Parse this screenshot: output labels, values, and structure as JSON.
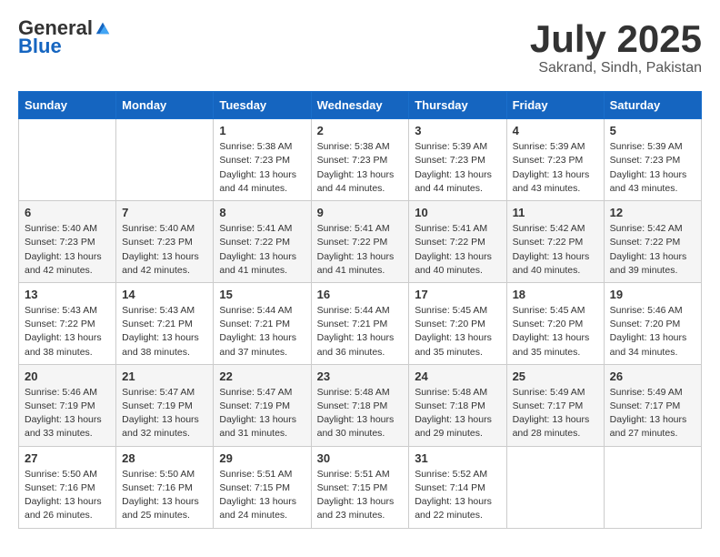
{
  "header": {
    "logo_general": "General",
    "logo_blue": "Blue",
    "month": "July 2025",
    "location": "Sakrand, Sindh, Pakistan"
  },
  "days_of_week": [
    "Sunday",
    "Monday",
    "Tuesday",
    "Wednesday",
    "Thursday",
    "Friday",
    "Saturday"
  ],
  "weeks": [
    [
      {
        "day": "",
        "sunrise": "",
        "sunset": "",
        "daylight": ""
      },
      {
        "day": "",
        "sunrise": "",
        "sunset": "",
        "daylight": ""
      },
      {
        "day": "1",
        "sunrise": "Sunrise: 5:38 AM",
        "sunset": "Sunset: 7:23 PM",
        "daylight": "Daylight: 13 hours and 44 minutes."
      },
      {
        "day": "2",
        "sunrise": "Sunrise: 5:38 AM",
        "sunset": "Sunset: 7:23 PM",
        "daylight": "Daylight: 13 hours and 44 minutes."
      },
      {
        "day": "3",
        "sunrise": "Sunrise: 5:39 AM",
        "sunset": "Sunset: 7:23 PM",
        "daylight": "Daylight: 13 hours and 44 minutes."
      },
      {
        "day": "4",
        "sunrise": "Sunrise: 5:39 AM",
        "sunset": "Sunset: 7:23 PM",
        "daylight": "Daylight: 13 hours and 43 minutes."
      },
      {
        "day": "5",
        "sunrise": "Sunrise: 5:39 AM",
        "sunset": "Sunset: 7:23 PM",
        "daylight": "Daylight: 13 hours and 43 minutes."
      }
    ],
    [
      {
        "day": "6",
        "sunrise": "Sunrise: 5:40 AM",
        "sunset": "Sunset: 7:23 PM",
        "daylight": "Daylight: 13 hours and 42 minutes."
      },
      {
        "day": "7",
        "sunrise": "Sunrise: 5:40 AM",
        "sunset": "Sunset: 7:23 PM",
        "daylight": "Daylight: 13 hours and 42 minutes."
      },
      {
        "day": "8",
        "sunrise": "Sunrise: 5:41 AM",
        "sunset": "Sunset: 7:22 PM",
        "daylight": "Daylight: 13 hours and 41 minutes."
      },
      {
        "day": "9",
        "sunrise": "Sunrise: 5:41 AM",
        "sunset": "Sunset: 7:22 PM",
        "daylight": "Daylight: 13 hours and 41 minutes."
      },
      {
        "day": "10",
        "sunrise": "Sunrise: 5:41 AM",
        "sunset": "Sunset: 7:22 PM",
        "daylight": "Daylight: 13 hours and 40 minutes."
      },
      {
        "day": "11",
        "sunrise": "Sunrise: 5:42 AM",
        "sunset": "Sunset: 7:22 PM",
        "daylight": "Daylight: 13 hours and 40 minutes."
      },
      {
        "day": "12",
        "sunrise": "Sunrise: 5:42 AM",
        "sunset": "Sunset: 7:22 PM",
        "daylight": "Daylight: 13 hours and 39 minutes."
      }
    ],
    [
      {
        "day": "13",
        "sunrise": "Sunrise: 5:43 AM",
        "sunset": "Sunset: 7:22 PM",
        "daylight": "Daylight: 13 hours and 38 minutes."
      },
      {
        "day": "14",
        "sunrise": "Sunrise: 5:43 AM",
        "sunset": "Sunset: 7:21 PM",
        "daylight": "Daylight: 13 hours and 38 minutes."
      },
      {
        "day": "15",
        "sunrise": "Sunrise: 5:44 AM",
        "sunset": "Sunset: 7:21 PM",
        "daylight": "Daylight: 13 hours and 37 minutes."
      },
      {
        "day": "16",
        "sunrise": "Sunrise: 5:44 AM",
        "sunset": "Sunset: 7:21 PM",
        "daylight": "Daylight: 13 hours and 36 minutes."
      },
      {
        "day": "17",
        "sunrise": "Sunrise: 5:45 AM",
        "sunset": "Sunset: 7:20 PM",
        "daylight": "Daylight: 13 hours and 35 minutes."
      },
      {
        "day": "18",
        "sunrise": "Sunrise: 5:45 AM",
        "sunset": "Sunset: 7:20 PM",
        "daylight": "Daylight: 13 hours and 35 minutes."
      },
      {
        "day": "19",
        "sunrise": "Sunrise: 5:46 AM",
        "sunset": "Sunset: 7:20 PM",
        "daylight": "Daylight: 13 hours and 34 minutes."
      }
    ],
    [
      {
        "day": "20",
        "sunrise": "Sunrise: 5:46 AM",
        "sunset": "Sunset: 7:19 PM",
        "daylight": "Daylight: 13 hours and 33 minutes."
      },
      {
        "day": "21",
        "sunrise": "Sunrise: 5:47 AM",
        "sunset": "Sunset: 7:19 PM",
        "daylight": "Daylight: 13 hours and 32 minutes."
      },
      {
        "day": "22",
        "sunrise": "Sunrise: 5:47 AM",
        "sunset": "Sunset: 7:19 PM",
        "daylight": "Daylight: 13 hours and 31 minutes."
      },
      {
        "day": "23",
        "sunrise": "Sunrise: 5:48 AM",
        "sunset": "Sunset: 7:18 PM",
        "daylight": "Daylight: 13 hours and 30 minutes."
      },
      {
        "day": "24",
        "sunrise": "Sunrise: 5:48 AM",
        "sunset": "Sunset: 7:18 PM",
        "daylight": "Daylight: 13 hours and 29 minutes."
      },
      {
        "day": "25",
        "sunrise": "Sunrise: 5:49 AM",
        "sunset": "Sunset: 7:17 PM",
        "daylight": "Daylight: 13 hours and 28 minutes."
      },
      {
        "day": "26",
        "sunrise": "Sunrise: 5:49 AM",
        "sunset": "Sunset: 7:17 PM",
        "daylight": "Daylight: 13 hours and 27 minutes."
      }
    ],
    [
      {
        "day": "27",
        "sunrise": "Sunrise: 5:50 AM",
        "sunset": "Sunset: 7:16 PM",
        "daylight": "Daylight: 13 hours and 26 minutes."
      },
      {
        "day": "28",
        "sunrise": "Sunrise: 5:50 AM",
        "sunset": "Sunset: 7:16 PM",
        "daylight": "Daylight: 13 hours and 25 minutes."
      },
      {
        "day": "29",
        "sunrise": "Sunrise: 5:51 AM",
        "sunset": "Sunset: 7:15 PM",
        "daylight": "Daylight: 13 hours and 24 minutes."
      },
      {
        "day": "30",
        "sunrise": "Sunrise: 5:51 AM",
        "sunset": "Sunset: 7:15 PM",
        "daylight": "Daylight: 13 hours and 23 minutes."
      },
      {
        "day": "31",
        "sunrise": "Sunrise: 5:52 AM",
        "sunset": "Sunset: 7:14 PM",
        "daylight": "Daylight: 13 hours and 22 minutes."
      },
      {
        "day": "",
        "sunrise": "",
        "sunset": "",
        "daylight": ""
      },
      {
        "day": "",
        "sunrise": "",
        "sunset": "",
        "daylight": ""
      }
    ]
  ]
}
